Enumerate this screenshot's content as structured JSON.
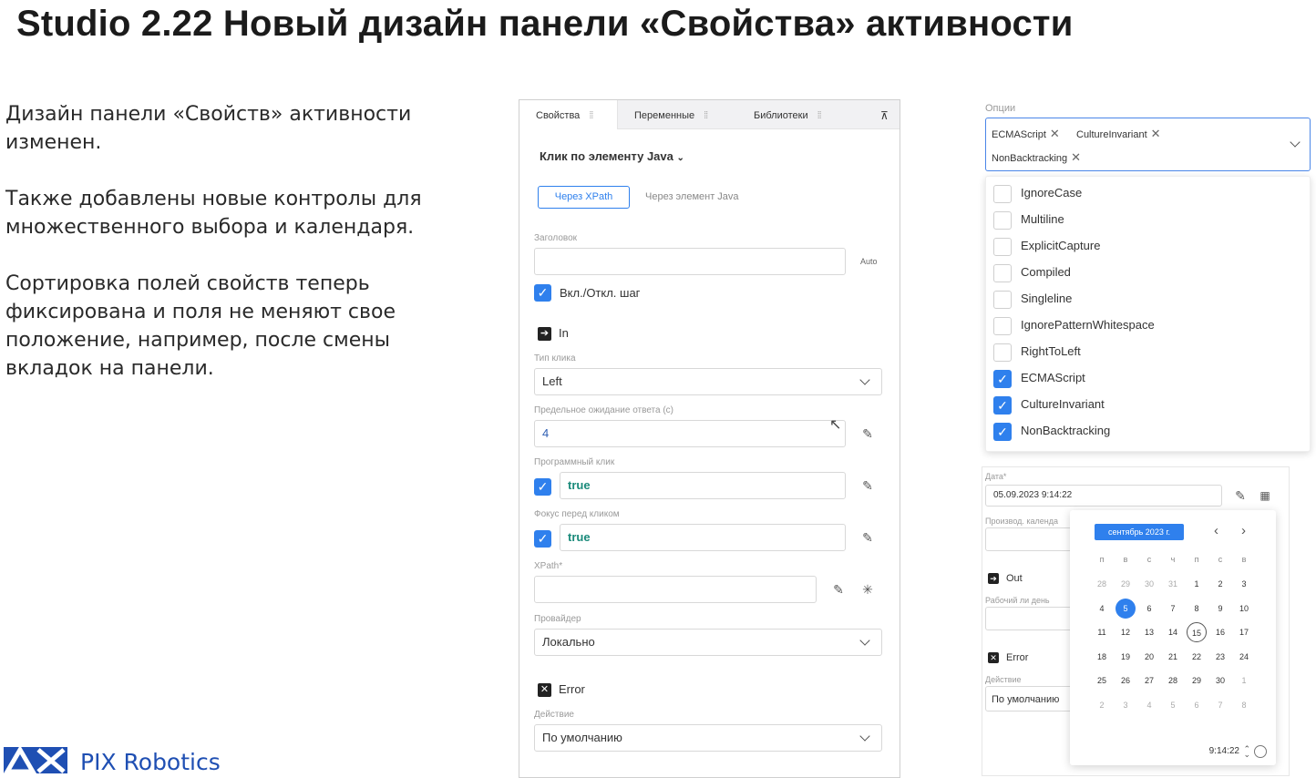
{
  "title": "Studio 2.22 Новый дизайн панели «Свойства» активности",
  "paragraphs": [
    "Дизайн панели «Свойств» активности изменен.",
    "Также добавлены новые контролы для множественного выбора и календаря.",
    "Сортировка полей свойств теперь фиксирована и поля не меняют свое положение, например, после смены вкладок на панели."
  ],
  "logo": {
    "name": "PIX Robotics",
    "color": "#1f4fb3"
  },
  "panel": {
    "tabs": [
      "Свойства",
      "Переменные",
      "Библиотеки"
    ],
    "pin_icon": "pin-icon",
    "activity_title": "Клик по элементу Java",
    "modes": {
      "xpath": "Через XPath",
      "element": "Через элемент Java"
    },
    "header_label": "Заголовок",
    "auto_label": "Auto",
    "toggle_step": "Вкл./Откл. шаг",
    "in_section": "In",
    "click_type_label": "Тип клика",
    "click_type_value": "Left",
    "timeout_label": "Предельное ожидание ответа (с)",
    "timeout_value": "4",
    "prog_click_label": "Программный клик",
    "prog_click_value": "true",
    "focus_label": "Фокус перед кликом",
    "focus_value": "true",
    "xpath_label": "XPath*",
    "provider_label": "Провайдер",
    "provider_value": "Локально",
    "error_section": "Error",
    "action_label": "Действие",
    "action_value": "По умолчанию"
  },
  "options": {
    "label": "Опции",
    "selected": [
      "ECMAScript",
      "CultureInvariant",
      "NonBacktracking"
    ],
    "items": [
      {
        "label": "IgnoreCase",
        "checked": false
      },
      {
        "label": "Multiline",
        "checked": false
      },
      {
        "label": "ExplicitCapture",
        "checked": false
      },
      {
        "label": "Compiled",
        "checked": false
      },
      {
        "label": "Singleline",
        "checked": false
      },
      {
        "label": "IgnorePatternWhitespace",
        "checked": false
      },
      {
        "label": "RightToLeft",
        "checked": false
      },
      {
        "label": "ECMAScript",
        "checked": true
      },
      {
        "label": "CultureInvariant",
        "checked": true
      },
      {
        "label": "NonBacktracking",
        "checked": true
      }
    ]
  },
  "lower": {
    "date_label": "Дата*",
    "date_value": "05.09.2023 9:14:22",
    "prod_calendar_label": "Производ. календа",
    "out_section": "Out",
    "workday_label": "Рабочий ли день",
    "error_section": "Error",
    "action_label": "Действие",
    "action_value": "По умолчанию"
  },
  "calendar": {
    "month": "сентябрь 2023 г.",
    "weekdays": [
      "п",
      "в",
      "с",
      "ч",
      "п",
      "с",
      "в"
    ],
    "days": [
      [
        "28",
        "29",
        "30",
        "31",
        "1",
        "2",
        "3"
      ],
      [
        "4",
        "5",
        "6",
        "7",
        "8",
        "9",
        "10"
      ],
      [
        "11",
        "12",
        "13",
        "14",
        "15",
        "16",
        "17"
      ],
      [
        "18",
        "19",
        "20",
        "21",
        "22",
        "23",
        "24"
      ],
      [
        "25",
        "26",
        "27",
        "28",
        "29",
        "30",
        "1"
      ],
      [
        "2",
        "3",
        "4",
        "5",
        "6",
        "7",
        "8"
      ]
    ],
    "selected": "5",
    "today": "15",
    "time": "9:14:22"
  }
}
